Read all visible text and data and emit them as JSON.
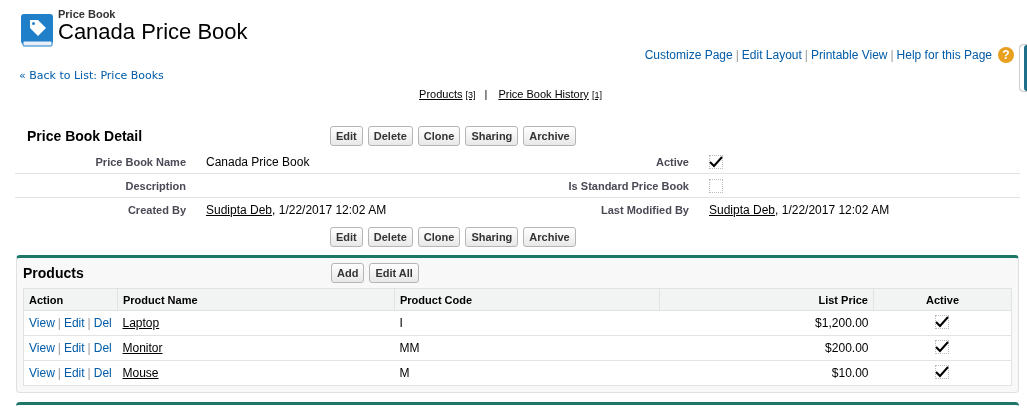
{
  "header": {
    "object_type": "Price Book",
    "title": "Canada Price Book"
  },
  "top_links": {
    "separator": "|",
    "help_glyph": "?",
    "items": [
      "Customize Page",
      "Edit Layout",
      "Printable View",
      "Help for this Page"
    ]
  },
  "back_link": "« Back to List: Price Books",
  "related_links": {
    "separator": "|",
    "items": [
      {
        "label": "Products",
        "count": "[3]"
      },
      {
        "label": "Price Book History",
        "count": "[1]"
      }
    ]
  },
  "detail": {
    "title": "Price Book Detail",
    "buttons": [
      "Edit",
      "Delete",
      "Clone",
      "Sharing",
      "Archive"
    ],
    "bottom_buttons": [
      "Edit",
      "Delete",
      "Clone",
      "Sharing",
      "Archive"
    ],
    "rows": [
      {
        "left": {
          "kind": "text",
          "label": "Price Book Name",
          "value": "Canada Price Book"
        },
        "right": {
          "kind": "checkbox",
          "label": "Active",
          "checked": true
        }
      },
      {
        "left": {
          "kind": "text",
          "label": "Description"
        },
        "right": {
          "kind": "checkbox",
          "label": "Is Standard Price Book",
          "checked": false
        }
      },
      {
        "left": {
          "kind": "user",
          "label": "Created By",
          "link": "Sudipta Deb",
          "value": ", 1/22/2017 12:02 AM"
        },
        "right": {
          "kind": "user",
          "label": "Last Modified By",
          "link": "Sudipta Deb",
          "value": ", 1/22/2017 12:02 AM"
        }
      }
    ]
  },
  "products": {
    "title": "Products",
    "buttons": [
      "Add",
      "Edit All"
    ],
    "columns": [
      "Action",
      "Product Name",
      "Product Code",
      "List Price",
      "Active"
    ],
    "action_separator": "|",
    "rows": [
      {
        "actions": [
          "View",
          "Edit",
          "Del"
        ],
        "name": "Laptop",
        "code": "I",
        "list_price": "$1,200.00",
        "active": true
      },
      {
        "actions": [
          "View",
          "Edit",
          "Del"
        ],
        "name": "Monitor",
        "code": "MM",
        "list_price": "$200.00",
        "active": true
      },
      {
        "actions": [
          "View",
          "Edit",
          "Del"
        ],
        "name": "Mouse",
        "code": "M",
        "list_price": "$10.00",
        "active": true
      }
    ]
  }
}
